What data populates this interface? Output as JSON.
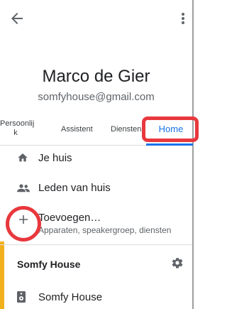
{
  "profile": {
    "name": "Marco de Gier",
    "email": "somfyhouse@gmail.com"
  },
  "tabs": {
    "personal": "Persoonlij\nk",
    "assistant": "Assistent",
    "services": "Diensten",
    "home": "Home"
  },
  "menu": {
    "my_home": "Je huis",
    "members": "Leden van huis",
    "add_label": "Toevoegen…",
    "add_sub": "Apparaten, speakergroep, diensten"
  },
  "home_section": {
    "title": "Somfy House",
    "device": "Somfy House"
  },
  "colors": {
    "accent_blue": "#1a73e8",
    "highlight_red": "#e8383d"
  }
}
